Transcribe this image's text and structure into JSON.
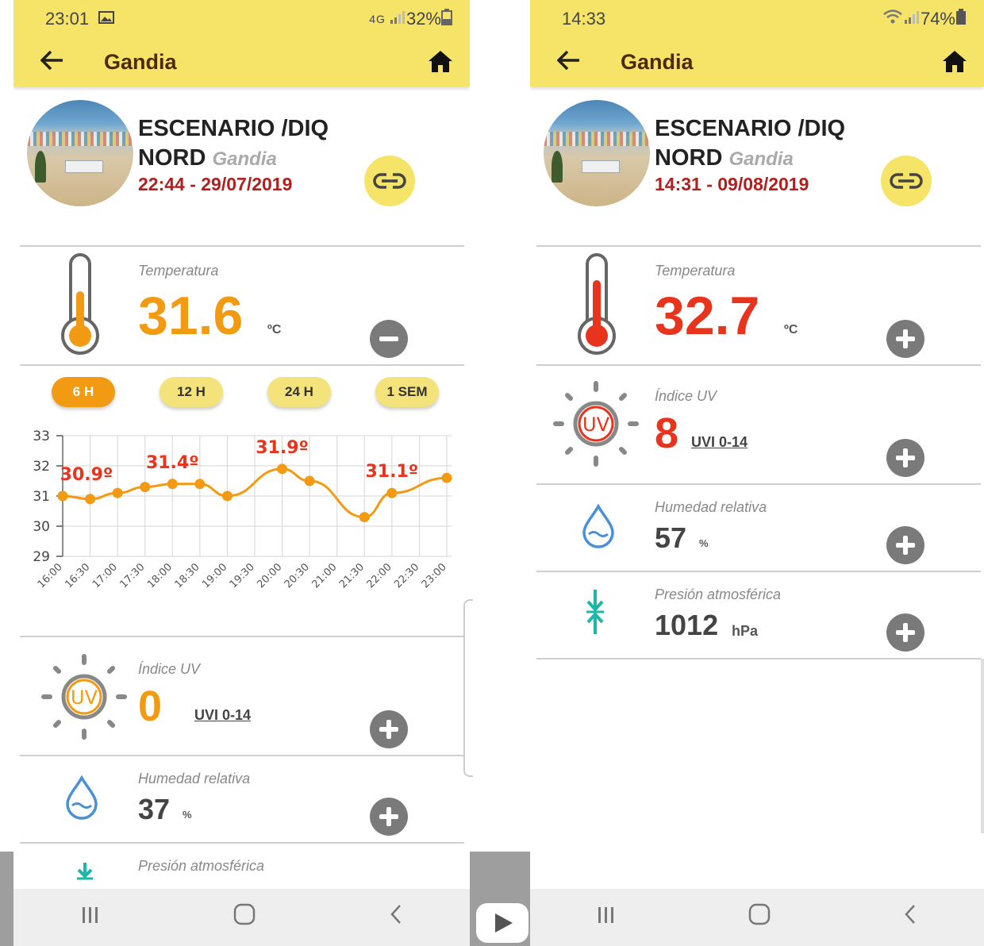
{
  "left": {
    "status": {
      "time": "23:01",
      "network": "4G",
      "battery": "32%"
    },
    "appbar": {
      "title": "Gandia"
    },
    "station": {
      "name_line1": "ESCENARIO /DIQ",
      "name_line2": "NORD",
      "city": "Gandia",
      "datetime": "22:44 - 29/07/2019"
    },
    "temperature": {
      "label": "Temperatura",
      "value": "31.6",
      "unit": "ºC",
      "color": "#f39a13"
    },
    "ranges": [
      "6 H",
      "12 H",
      "24 H",
      "1 SEM"
    ],
    "uv": {
      "label": "Índice UV",
      "value": "0",
      "scale": "UVI 0-14",
      "color": "#f39a13"
    },
    "humidity": {
      "label": "Humedad relativa",
      "value": "37",
      "unit": "%"
    },
    "pressure": {
      "label": "Presión atmosférica"
    }
  },
  "right": {
    "status": {
      "time": "14:33",
      "battery": "74%"
    },
    "appbar": {
      "title": "Gandia"
    },
    "station": {
      "name_line1": "ESCENARIO /DIQ",
      "name_line2": "NORD",
      "city": "Gandia",
      "datetime": "14:31 - 09/08/2019"
    },
    "temperature": {
      "label": "Temperatura",
      "value": "32.7",
      "unit": "ºC",
      "color": "#e8341c"
    },
    "uv": {
      "label": "Índice UV",
      "value": "8",
      "scale": "UVI 0-14",
      "color": "#e8341c"
    },
    "humidity": {
      "label": "Humedad relativa",
      "value": "57",
      "unit": "%"
    },
    "pressure": {
      "label": "Presión atmosférica",
      "value": "1012",
      "unit": "hPa"
    }
  },
  "colors": {
    "appbar": "#f6e468",
    "accent_orange": "#f39a13",
    "accent_red": "#e8341c",
    "date_red": "#b11f1f",
    "teal": "#1bb7a8",
    "water_blue": "#4a90d9"
  },
  "chart_data": {
    "type": "line",
    "x": [
      "16:00",
      "16:30",
      "17:00",
      "17:30",
      "18:00",
      "18:30",
      "19:00",
      "19:30",
      "20:00",
      "20:30",
      "21:00",
      "21:30",
      "22:00",
      "22:30",
      "23:00"
    ],
    "series": [
      {
        "values": [
          31.0,
          30.9,
          31.1,
          31.3,
          31.4,
          31.4,
          31.0,
          null,
          31.9,
          31.5,
          null,
          30.3,
          31.1,
          null,
          31.6
        ]
      }
    ],
    "annotations": [
      {
        "x": "16:00",
        "label": "30.9º"
      },
      {
        "x": "18:00",
        "label": "31.4º"
      },
      {
        "x": "20:00",
        "label": "31.9º"
      },
      {
        "x": "22:00",
        "label": "31.1º"
      }
    ],
    "yticks": [
      "29",
      "30",
      "31",
      "32",
      "33"
    ],
    "ylim": [
      29,
      33
    ],
    "grid": true,
    "line_color": "#f39a13",
    "label_color": "#e8341c"
  }
}
